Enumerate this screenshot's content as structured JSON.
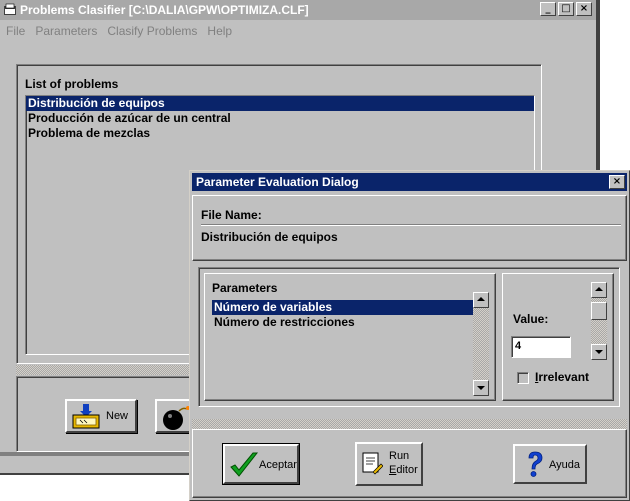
{
  "main_window": {
    "title": "Problems Clasifier [C:\\DALIA\\GPW\\OPTIMIZA.CLF]",
    "caption_buttons": [
      "_",
      "□",
      "×"
    ],
    "menu": [
      "File",
      "Parameters",
      "Clasify Problems",
      "Help"
    ],
    "list_label": "List of problems",
    "problems": [
      "Distribución de equipos",
      "Producción de azúcar de un central",
      "Problema de mezclas"
    ],
    "selected_problem_index": 0,
    "buttons": {
      "new_label": "New"
    }
  },
  "dialog": {
    "title": "Parameter Evaluation Dialog",
    "close_glyph": "×",
    "file_name_label": "File Name:",
    "file_name_value": "Distribución de equipos",
    "parameters_label": "Parameters",
    "parameters": [
      "Número de variables",
      "Número de restricciones"
    ],
    "selected_parameter_index": 0,
    "value_label": "Value:",
    "value": "4",
    "irrelevant_label_accel": "I",
    "irrelevant_label_rest": "rrelevant",
    "irrelevant_checked": false,
    "buttons": {
      "aceptar": "Aceptar",
      "run_line1": "Run",
      "run_accel": "E",
      "run_line2_rest": "ditor",
      "ayuda": "Ayuda"
    }
  },
  "colors": {
    "active_title": "#0a246a",
    "inactive_title": "#a8a8a8",
    "face": "#c0c0c0",
    "selection": "#0a246a"
  }
}
